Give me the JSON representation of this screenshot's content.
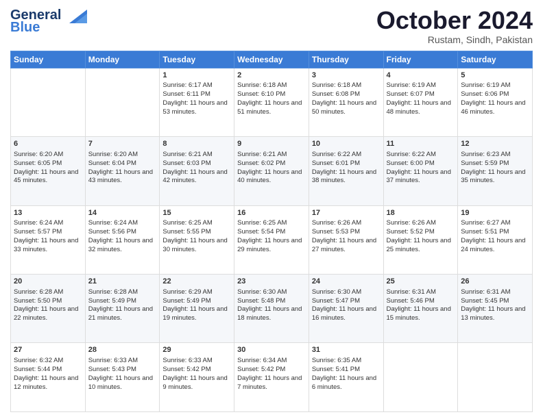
{
  "logo": {
    "line1": "General",
    "line2": "Blue"
  },
  "header": {
    "month": "October 2024",
    "location": "Rustam, Sindh, Pakistan"
  },
  "days_of_week": [
    "Sunday",
    "Monday",
    "Tuesday",
    "Wednesday",
    "Thursday",
    "Friday",
    "Saturday"
  ],
  "weeks": [
    [
      {
        "day": "",
        "content": ""
      },
      {
        "day": "",
        "content": ""
      },
      {
        "day": "1",
        "content": "Sunrise: 6:17 AM\nSunset: 6:11 PM\nDaylight: 11 hours and 53 minutes."
      },
      {
        "day": "2",
        "content": "Sunrise: 6:18 AM\nSunset: 6:10 PM\nDaylight: 11 hours and 51 minutes."
      },
      {
        "day": "3",
        "content": "Sunrise: 6:18 AM\nSunset: 6:08 PM\nDaylight: 11 hours and 50 minutes."
      },
      {
        "day": "4",
        "content": "Sunrise: 6:19 AM\nSunset: 6:07 PM\nDaylight: 11 hours and 48 minutes."
      },
      {
        "day": "5",
        "content": "Sunrise: 6:19 AM\nSunset: 6:06 PM\nDaylight: 11 hours and 46 minutes."
      }
    ],
    [
      {
        "day": "6",
        "content": "Sunrise: 6:20 AM\nSunset: 6:05 PM\nDaylight: 11 hours and 45 minutes."
      },
      {
        "day": "7",
        "content": "Sunrise: 6:20 AM\nSunset: 6:04 PM\nDaylight: 11 hours and 43 minutes."
      },
      {
        "day": "8",
        "content": "Sunrise: 6:21 AM\nSunset: 6:03 PM\nDaylight: 11 hours and 42 minutes."
      },
      {
        "day": "9",
        "content": "Sunrise: 6:21 AM\nSunset: 6:02 PM\nDaylight: 11 hours and 40 minutes."
      },
      {
        "day": "10",
        "content": "Sunrise: 6:22 AM\nSunset: 6:01 PM\nDaylight: 11 hours and 38 minutes."
      },
      {
        "day": "11",
        "content": "Sunrise: 6:22 AM\nSunset: 6:00 PM\nDaylight: 11 hours and 37 minutes."
      },
      {
        "day": "12",
        "content": "Sunrise: 6:23 AM\nSunset: 5:59 PM\nDaylight: 11 hours and 35 minutes."
      }
    ],
    [
      {
        "day": "13",
        "content": "Sunrise: 6:24 AM\nSunset: 5:57 PM\nDaylight: 11 hours and 33 minutes."
      },
      {
        "day": "14",
        "content": "Sunrise: 6:24 AM\nSunset: 5:56 PM\nDaylight: 11 hours and 32 minutes."
      },
      {
        "day": "15",
        "content": "Sunrise: 6:25 AM\nSunset: 5:55 PM\nDaylight: 11 hours and 30 minutes."
      },
      {
        "day": "16",
        "content": "Sunrise: 6:25 AM\nSunset: 5:54 PM\nDaylight: 11 hours and 29 minutes."
      },
      {
        "day": "17",
        "content": "Sunrise: 6:26 AM\nSunset: 5:53 PM\nDaylight: 11 hours and 27 minutes."
      },
      {
        "day": "18",
        "content": "Sunrise: 6:26 AM\nSunset: 5:52 PM\nDaylight: 11 hours and 25 minutes."
      },
      {
        "day": "19",
        "content": "Sunrise: 6:27 AM\nSunset: 5:51 PM\nDaylight: 11 hours and 24 minutes."
      }
    ],
    [
      {
        "day": "20",
        "content": "Sunrise: 6:28 AM\nSunset: 5:50 PM\nDaylight: 11 hours and 22 minutes."
      },
      {
        "day": "21",
        "content": "Sunrise: 6:28 AM\nSunset: 5:49 PM\nDaylight: 11 hours and 21 minutes."
      },
      {
        "day": "22",
        "content": "Sunrise: 6:29 AM\nSunset: 5:49 PM\nDaylight: 11 hours and 19 minutes."
      },
      {
        "day": "23",
        "content": "Sunrise: 6:30 AM\nSunset: 5:48 PM\nDaylight: 11 hours and 18 minutes."
      },
      {
        "day": "24",
        "content": "Sunrise: 6:30 AM\nSunset: 5:47 PM\nDaylight: 11 hours and 16 minutes."
      },
      {
        "day": "25",
        "content": "Sunrise: 6:31 AM\nSunset: 5:46 PM\nDaylight: 11 hours and 15 minutes."
      },
      {
        "day": "26",
        "content": "Sunrise: 6:31 AM\nSunset: 5:45 PM\nDaylight: 11 hours and 13 minutes."
      }
    ],
    [
      {
        "day": "27",
        "content": "Sunrise: 6:32 AM\nSunset: 5:44 PM\nDaylight: 11 hours and 12 minutes."
      },
      {
        "day": "28",
        "content": "Sunrise: 6:33 AM\nSunset: 5:43 PM\nDaylight: 11 hours and 10 minutes."
      },
      {
        "day": "29",
        "content": "Sunrise: 6:33 AM\nSunset: 5:42 PM\nDaylight: 11 hours and 9 minutes."
      },
      {
        "day": "30",
        "content": "Sunrise: 6:34 AM\nSunset: 5:42 PM\nDaylight: 11 hours and 7 minutes."
      },
      {
        "day": "31",
        "content": "Sunrise: 6:35 AM\nSunset: 5:41 PM\nDaylight: 11 hours and 6 minutes."
      },
      {
        "day": "",
        "content": ""
      },
      {
        "day": "",
        "content": ""
      }
    ]
  ]
}
